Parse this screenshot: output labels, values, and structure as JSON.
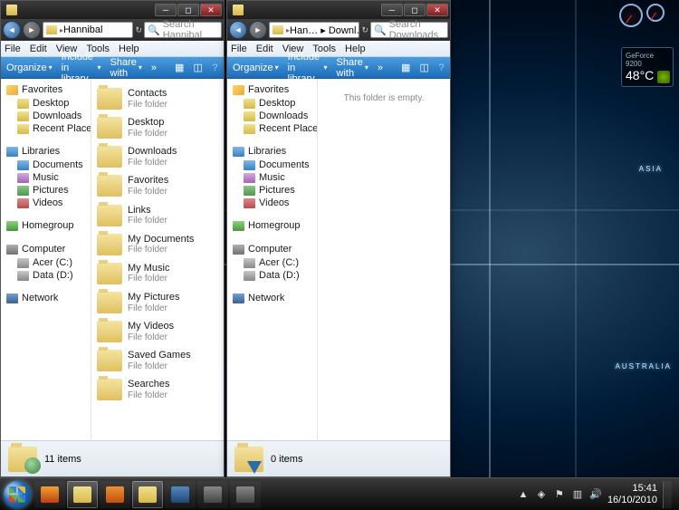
{
  "windows": [
    {
      "breadcrumb": "Hannibal",
      "search_placeholder": "Search Hannibal",
      "status": "11 items",
      "status_kind": "user",
      "content_empty": false,
      "folders": [
        {
          "name": "Contacts",
          "type": "File folder"
        },
        {
          "name": "Desktop",
          "type": "File folder"
        },
        {
          "name": "Downloads",
          "type": "File folder"
        },
        {
          "name": "Favorites",
          "type": "File folder"
        },
        {
          "name": "Links",
          "type": "File folder"
        },
        {
          "name": "My Documents",
          "type": "File folder"
        },
        {
          "name": "My Music",
          "type": "File folder"
        },
        {
          "name": "My Pictures",
          "type": "File folder"
        },
        {
          "name": "My Videos",
          "type": "File folder"
        },
        {
          "name": "Saved Games",
          "type": "File folder"
        },
        {
          "name": "Searches",
          "type": "File folder"
        }
      ]
    },
    {
      "breadcrumb": "Han… ▸ Downl…",
      "search_placeholder": "Search Downloads",
      "status": "0 items",
      "status_kind": "dl",
      "content_empty": true,
      "empty_text": "This folder is empty.",
      "folders": []
    }
  ],
  "menus": [
    "File",
    "Edit",
    "View",
    "Tools",
    "Help"
  ],
  "toolbar": {
    "organize": "Organize",
    "include": "Include in library",
    "share": "Share with"
  },
  "nav": {
    "favorites": {
      "label": "Favorites",
      "items": [
        "Desktop",
        "Downloads",
        "Recent Places"
      ]
    },
    "libraries": {
      "label": "Libraries",
      "items": [
        "Documents",
        "Music",
        "Pictures",
        "Videos"
      ]
    },
    "homegroup": {
      "label": "Homegroup"
    },
    "computer": {
      "label": "Computer",
      "items": [
        "Acer (C:)",
        "Data (D:)"
      ]
    },
    "network": {
      "label": "Network"
    }
  },
  "world_labels": {
    "asia": "ASIA",
    "australia": "AUSTRALIA"
  },
  "gadgets": {
    "gpu_name": "GeForce 9200",
    "gpu_temp": "48°C"
  },
  "tray": {
    "time": "15:41",
    "date": "16/10/2010"
  },
  "taskbar_apps": [
    {
      "name": "firefox",
      "color": "linear-gradient(#f0a030,#c04010)"
    },
    {
      "name": "explorer",
      "color": "linear-gradient(#f2e08c,#d8b84b)",
      "active": true
    },
    {
      "name": "wmp",
      "color": "linear-gradient(#f09030,#c05010)"
    },
    {
      "name": "explorer2",
      "color": "linear-gradient(#f2e08c,#d8b84b)",
      "active": true
    },
    {
      "name": "app5",
      "color": "linear-gradient(#5088c0,#204878)"
    },
    {
      "name": "app6",
      "color": "linear-gradient(#888,#444)"
    },
    {
      "name": "app7",
      "color": "linear-gradient(#888,#444)"
    }
  ]
}
